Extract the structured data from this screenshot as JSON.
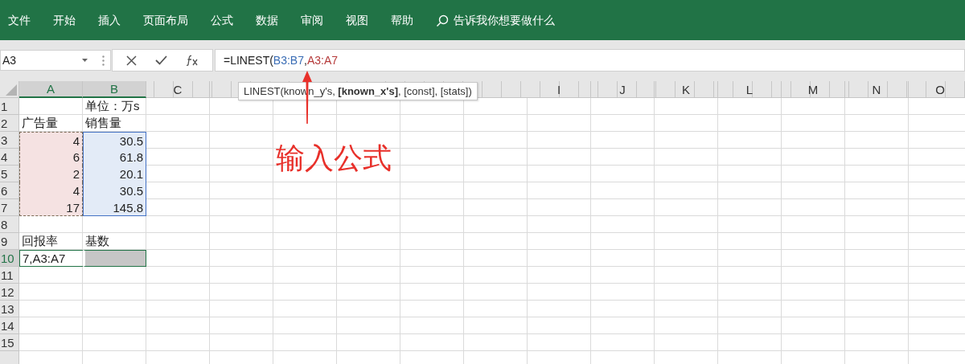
{
  "ribbon_tabs": [
    {
      "label": "文件"
    },
    {
      "label": "开始"
    },
    {
      "label": "插入"
    },
    {
      "label": "页面布局"
    },
    {
      "label": "公式"
    },
    {
      "label": "数据"
    },
    {
      "label": "审阅"
    },
    {
      "label": "视图"
    },
    {
      "label": "帮助"
    }
  ],
  "tell_me": {
    "placeholder": "告诉我你想要做什么"
  },
  "name_box": {
    "value": "A3"
  },
  "formula_parts": [
    {
      "kind": "plain",
      "text": "=LINEST("
    },
    {
      "kind": "reference",
      "text": "B3:B7",
      "color": "#3a6db5"
    },
    {
      "kind": "plain",
      "text": ","
    },
    {
      "kind": "reference",
      "text": "A3:A7",
      "color": "#b53a3a"
    }
  ],
  "tooltip": "LINEST(known_y's, **[known_x's]**, [const], [stats])",
  "columns": [
    {
      "kind": "letter",
      "letter": "A",
      "selected": true
    },
    {
      "kind": "letter",
      "letter": "B",
      "selected": true
    },
    {
      "kind": "letter",
      "letter": "C",
      "selected": false
    },
    {
      "kind": "covered"
    },
    {
      "kind": "covered"
    },
    {
      "kind": "covered"
    },
    {
      "kind": "covered"
    },
    {
      "kind": "covered"
    },
    {
      "kind": "letter",
      "letter": "I",
      "selected": false
    },
    {
      "kind": "letter",
      "letter": "J",
      "selected": false
    },
    {
      "kind": "letter",
      "letter": "K",
      "selected": false
    },
    {
      "kind": "letter",
      "letter": "L",
      "selected": false
    },
    {
      "kind": "letter",
      "letter": "M",
      "selected": false
    },
    {
      "kind": "letter",
      "letter": "N",
      "selected": false
    },
    {
      "kind": "letter",
      "letter": "O",
      "selected": false
    }
  ],
  "rows": [
    {
      "number": "1",
      "selected": false,
      "cells": [
        {
          "kind": "blank"
        },
        {
          "kind": "label",
          "text": "单位：万s"
        }
      ]
    },
    {
      "number": "2",
      "selected": false,
      "cells": [
        {
          "kind": "label",
          "text": "广告量"
        },
        {
          "kind": "label",
          "text": "销售量"
        }
      ]
    },
    {
      "number": "3",
      "selected": false,
      "cells": [
        {
          "kind": "x_value",
          "text": "4"
        },
        {
          "kind": "y_value",
          "text": "30.5"
        }
      ]
    },
    {
      "number": "4",
      "selected": false,
      "cells": [
        {
          "kind": "x_value",
          "text": "6"
        },
        {
          "kind": "y_value",
          "text": "61.8"
        }
      ]
    },
    {
      "number": "5",
      "selected": false,
      "cells": [
        {
          "kind": "x_value",
          "text": "2"
        },
        {
          "kind": "y_value",
          "text": "20.1"
        }
      ]
    },
    {
      "number": "6",
      "selected": false,
      "cells": [
        {
          "kind": "x_value",
          "text": "4"
        },
        {
          "kind": "y_value",
          "text": "30.5"
        }
      ]
    },
    {
      "number": "7",
      "selected": false,
      "cells": [
        {
          "kind": "x_value",
          "text": "17"
        },
        {
          "kind": "y_value",
          "text": "145.8"
        }
      ]
    },
    {
      "number": "8",
      "selected": false,
      "cells": [
        {
          "kind": "blank"
        },
        {
          "kind": "blank"
        }
      ]
    },
    {
      "number": "9",
      "selected": false,
      "cells": [
        {
          "kind": "label",
          "text": "回报率"
        },
        {
          "kind": "label",
          "text": "基数"
        }
      ]
    },
    {
      "number": "10",
      "selected": true,
      "cells": [
        {
          "kind": "entry",
          "text": "7,A3:A7"
        },
        {
          "kind": "result"
        }
      ]
    },
    {
      "number": "11",
      "selected": false,
      "cells": [
        {
          "kind": "blank"
        },
        {
          "kind": "blank"
        }
      ]
    },
    {
      "number": "12",
      "selected": false,
      "cells": [
        {
          "kind": "blank"
        },
        {
          "kind": "blank"
        }
      ]
    },
    {
      "number": "13",
      "selected": false,
      "cells": [
        {
          "kind": "blank"
        },
        {
          "kind": "blank"
        }
      ]
    },
    {
      "number": "14",
      "selected": false,
      "cells": [
        {
          "kind": "blank"
        },
        {
          "kind": "blank"
        }
      ]
    },
    {
      "number": "15",
      "selected": false,
      "cells": [
        {
          "kind": "blank"
        },
        {
          "kind": "blank"
        }
      ]
    }
  ],
  "annotation": {
    "text": "输入公式"
  }
}
